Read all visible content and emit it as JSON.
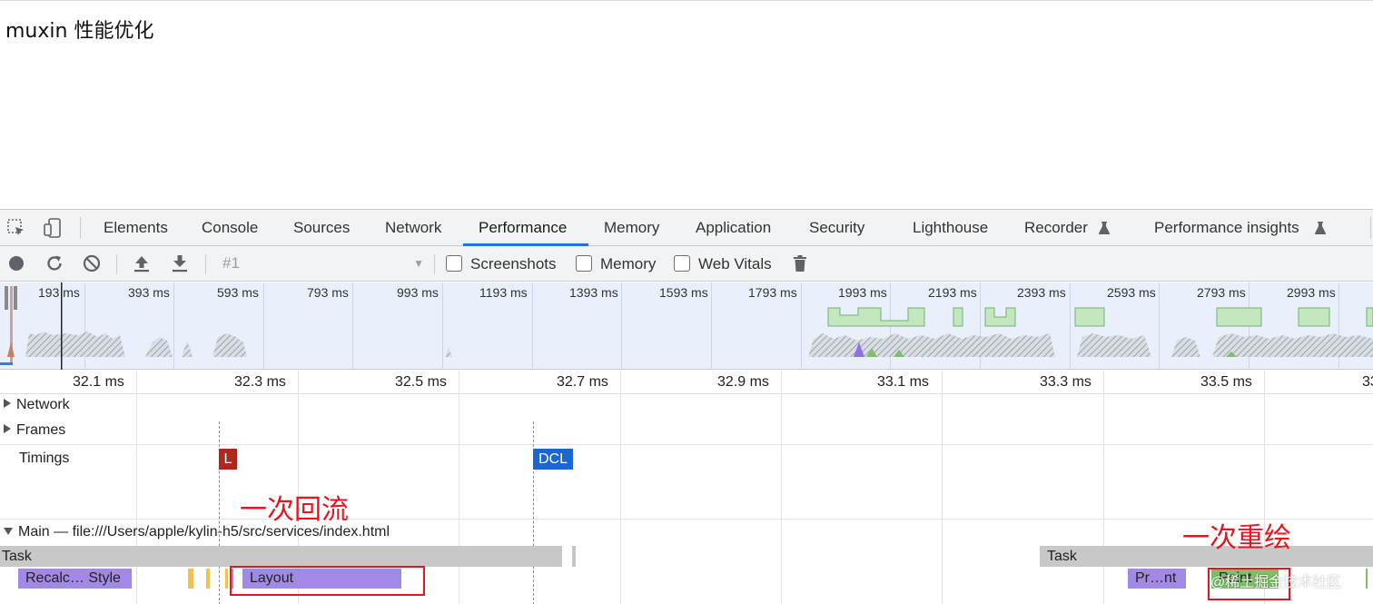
{
  "page": {
    "heading": "muxin 性能优化"
  },
  "devtools": {
    "tabs": [
      {
        "label": "Elements"
      },
      {
        "label": "Console"
      },
      {
        "label": "Sources"
      },
      {
        "label": "Network"
      },
      {
        "label": "Performance",
        "active": true
      },
      {
        "label": "Memory"
      },
      {
        "label": "Application"
      },
      {
        "label": "Security"
      },
      {
        "label": "Lighthouse"
      },
      {
        "label": "Recorder"
      },
      {
        "label": "Performance insights"
      }
    ],
    "toolbar": {
      "profile_select_value": "#1",
      "screenshots_label": "Screenshots",
      "memory_label": "Memory",
      "web_vitals_label": "Web Vitals"
    },
    "overview_ticks": [
      "193 ms",
      "393 ms",
      "593 ms",
      "793 ms",
      "993 ms",
      "1193 ms",
      "1393 ms",
      "1593 ms",
      "1793 ms",
      "1993 ms",
      "2193 ms",
      "2393 ms",
      "2593 ms",
      "2793 ms",
      "2993 ms"
    ],
    "ruler_ticks": [
      "32.1 ms",
      "32.3 ms",
      "32.5 ms",
      "32.7 ms",
      "32.9 ms",
      "33.1 ms",
      "33.3 ms",
      "33.5 ms",
      "33"
    ],
    "tracks": {
      "network": "Network",
      "frames": "Frames",
      "timings": "Timings",
      "main": "Main — file:///Users/apple/kylin-h5/src/services/index.html"
    },
    "markers": {
      "load": "L",
      "dcl": "DCL"
    },
    "events": {
      "task_1": "Task",
      "task_2": "Task",
      "recalc_style": "Recalc… Style",
      "layout": "Layout",
      "pre_paint": "Pr…nt",
      "paint": "Paint"
    },
    "colors": {
      "accent": "#1a73e8",
      "load_marker": "#b3261e",
      "dcl_marker": "#1967d2",
      "rendering": "#a389e6",
      "painting": "#7dbf6b",
      "annotation": "#e5161d"
    }
  },
  "annotations": {
    "reflow": "一次回流",
    "repaint": "一次重绘",
    "watermark": "@稀土掘金技术社区"
  }
}
